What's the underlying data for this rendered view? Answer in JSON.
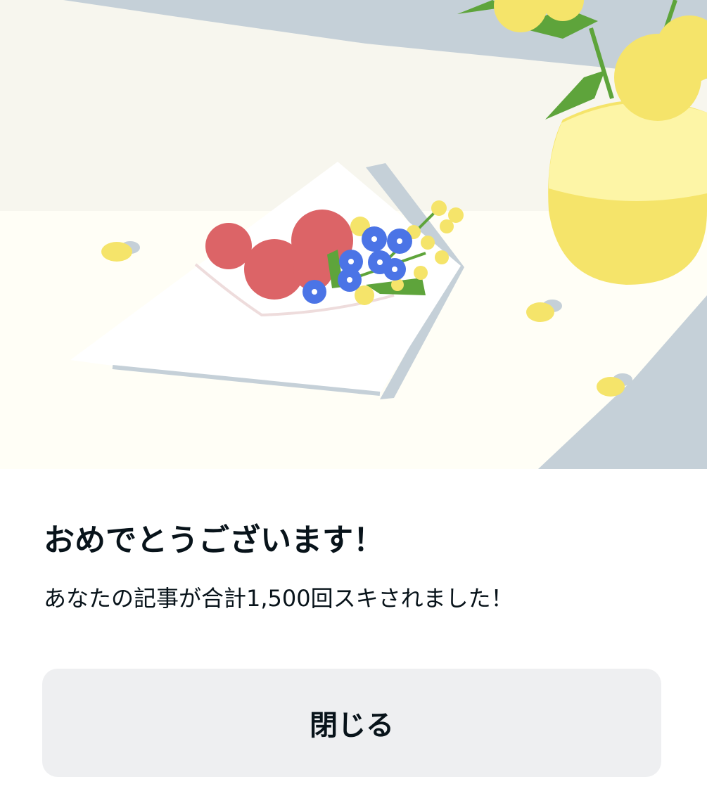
{
  "dialog": {
    "title": "おめでとうございます！",
    "message": "あなたの記事が合計1,500回スキされました！",
    "close_label": "閉じる"
  },
  "illustration": {
    "subject": "flowers-on-napkin-with-yellow-vase"
  },
  "colors": {
    "wall": "#f7f6ef",
    "table": "#fffef5",
    "shadow": "#c5d0d8",
    "red_flower": "#dc6467",
    "blue_flower": "#4b74e6",
    "yellow": "#f5e46a",
    "leaf": "#5ea43b",
    "button_bg": "#eeeff1",
    "text": "#08131a"
  }
}
